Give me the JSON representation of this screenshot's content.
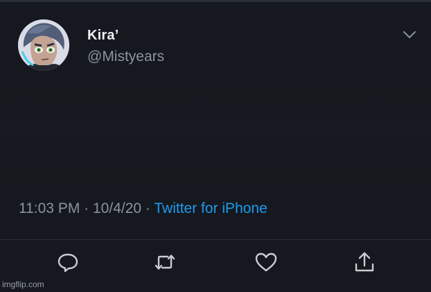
{
  "tweet": {
    "display_name": "Kira’",
    "handle": "@Mistyears",
    "time": "11:03 PM",
    "date": "10/4/20",
    "separator": " · ",
    "source": "Twitter for iPhone",
    "menu_icon": "chevron-down-icon"
  },
  "actions": [
    {
      "name": "reply",
      "icon": "reply-icon"
    },
    {
      "name": "retweet",
      "icon": "retweet-icon"
    },
    {
      "name": "like",
      "icon": "heart-icon"
    },
    {
      "name": "share",
      "icon": "share-icon"
    }
  ],
  "watermark": "imgflip.com",
  "colors": {
    "background": "#15181e",
    "text_primary": "#eef0f2",
    "text_secondary": "#8b949c",
    "link": "#1d9bf0"
  }
}
